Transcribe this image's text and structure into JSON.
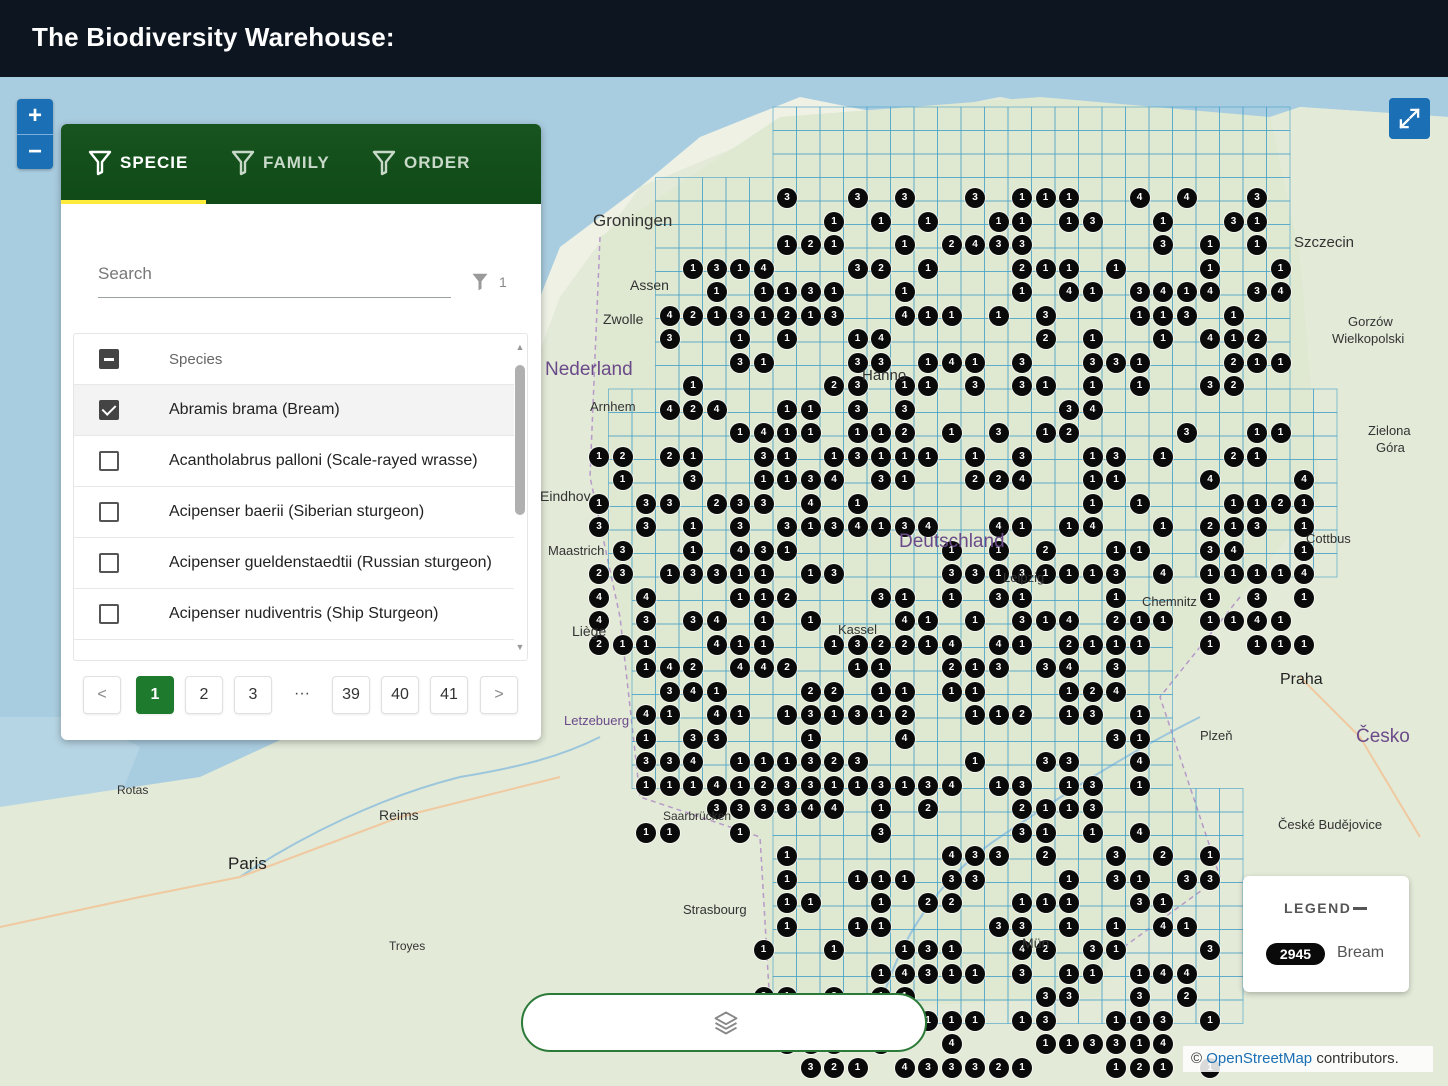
{
  "header": {
    "title": "The Biodiversity Warehouse:"
  },
  "map": {
    "zoom_in": "+",
    "zoom_out": "−",
    "fullscreen_icon": "expand-icon",
    "labels": {
      "groningen": "Groningen",
      "assen": "Assen",
      "zwolle": "Zwolle",
      "nederland": "Nederland",
      "arnhem": "Arnhem",
      "eindhoven": "Eindhov",
      "maastricht": "Maastrich",
      "liege": "Liège",
      "letzebuerg": "Letzebuerg",
      "saarbrucken": "Saarbrücken",
      "strasbourg": "Strasbourg",
      "reims": "Reims",
      "paris": "Paris",
      "troyes": "Troyes",
      "rotas": "Rotas",
      "deutschland": "Deutschland",
      "kassel": "Kassel",
      "hannover": "Hanno",
      "leipzig": "Leipzig",
      "chemnitz": "Chemnitz",
      "szczecin": "Szczecin",
      "gorzow": "Gorzów",
      "gorzow2": "Wielkopolski",
      "zielona": "Zielona",
      "gora": "Góra",
      "cottbus": "Cottbus",
      "praha": "Praha",
      "cesko": "Česko",
      "plzen": "Plzeň",
      "budejovice": "České Budějovice",
      "munich": "Mün"
    }
  },
  "panel": {
    "tabs": [
      {
        "label": "SPECIE",
        "icon": "filter-icon",
        "active": true
      },
      {
        "label": "FAMILY",
        "icon": "filter-icon",
        "active": false
      },
      {
        "label": "ORDER",
        "icon": "filter-icon",
        "active": false
      }
    ],
    "search": {
      "placeholder": "Search",
      "value": ""
    },
    "filter_count": "1",
    "list_header": "Species",
    "items": [
      {
        "name": "Abramis brama",
        "common": "(Bream)",
        "checked": true
      },
      {
        "name": "Acantholabrus palloni",
        "common": "(Scale-rayed wrasse)",
        "checked": false
      },
      {
        "name": "Acipenser baerii",
        "common": "(Siberian sturgeon)",
        "checked": false
      },
      {
        "name": "Acipenser gueldenstaedtii",
        "common": "(Russian sturgeon)",
        "checked": false
      },
      {
        "name": "Acipenser nudiventris",
        "common": "(Ship Sturgeon)",
        "checked": false
      }
    ],
    "pagination": {
      "prev": "<",
      "pages": [
        "1",
        "2",
        "3"
      ],
      "ellipsis": "···",
      "last_pages": [
        "39",
        "40",
        "41"
      ],
      "next": ">",
      "current": "1"
    }
  },
  "legend": {
    "title": "LEGEND",
    "count": "2945",
    "series": "Bream"
  },
  "layers_icon": "layers-icon",
  "attribution": {
    "prefix": "©",
    "link": "OpenStreetMap",
    "suffix": "contributors."
  },
  "colors": {
    "header_bg": "#0c1520",
    "panel_tab_green": "#18541f",
    "accent_blue": "#1a6fb5",
    "active_page": "#1e7a2c",
    "tab_underline": "#ffeb3b",
    "cluster": "#0a0a0a"
  }
}
